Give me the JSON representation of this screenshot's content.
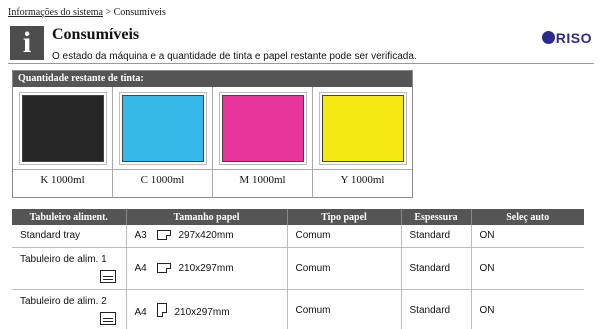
{
  "breadcrumb": {
    "parent": "Informações do sistema",
    "separator": ">",
    "current": "Consumíveis"
  },
  "header": {
    "info_icon": "i",
    "title": "Consumíveis",
    "description": "O estado da máquina e a quantidade de tinta e papel restante pode ser verificada.",
    "logo_text": "RISO"
  },
  "ink": {
    "heading": "Quantidade restante de tinta:",
    "items": [
      {
        "label": "K 1000ml",
        "color": "#262626"
      },
      {
        "label": "C 1000ml",
        "color": "#37b9e9"
      },
      {
        "label": "M 1000ml",
        "color": "#e7359c"
      },
      {
        "label": "Y 1000ml",
        "color": "#f6e812"
      }
    ]
  },
  "trays": {
    "headers": [
      "Tabuleiro aliment.",
      "Tamanho papel",
      "Tipo papel",
      "Espessura",
      "Seleç auto"
    ],
    "rows": [
      {
        "name": "Standard tray",
        "size_code": "A3",
        "orientation": "landscape",
        "size": "297x420mm",
        "type": "Comum",
        "thickness": "Standard",
        "auto": "ON"
      },
      {
        "name": "Tabuleiro de alim. 1",
        "size_code": "A4",
        "orientation": "landscape",
        "size": "210x297mm",
        "type": "Comum",
        "thickness": "Standard",
        "auto": "ON"
      },
      {
        "name": "Tabuleiro de alim. 2",
        "size_code": "A4",
        "orientation": "portrait",
        "size": "210x297mm",
        "type": "Comum",
        "thickness": "Standard",
        "auto": "ON"
      }
    ]
  }
}
